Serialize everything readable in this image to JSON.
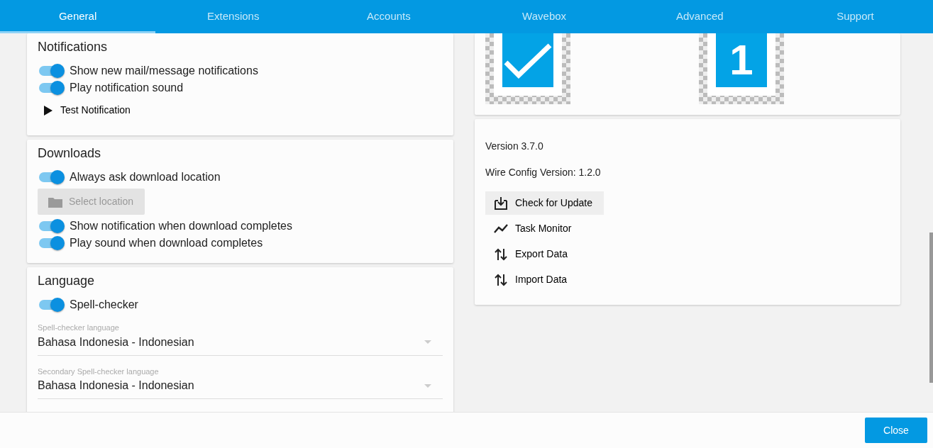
{
  "tabs": [
    {
      "label": "General",
      "selected": true
    },
    {
      "label": "Extensions",
      "selected": false
    },
    {
      "label": "Accounts",
      "selected": false
    },
    {
      "label": "Wavebox",
      "selected": false
    },
    {
      "label": "Advanced",
      "selected": false
    },
    {
      "label": "Support",
      "selected": false
    }
  ],
  "left_cards": [
    {
      "title": "Notifications",
      "items": [
        {
          "kind": "toggle",
          "label": "Show new mail/message notifications",
          "on": true
        },
        {
          "kind": "toggle",
          "label": "Play notification sound",
          "on": true
        },
        {
          "kind": "action",
          "label": "Test Notification"
        }
      ]
    },
    {
      "title": "Downloads",
      "items": [
        {
          "kind": "toggle",
          "label": "Always ask download location",
          "on": true
        },
        {
          "kind": "button",
          "label": "Select location",
          "disabled": true
        },
        {
          "kind": "toggle",
          "label": "Show notification when download completes",
          "on": true
        },
        {
          "kind": "toggle",
          "label": "Play sound when download completes",
          "on": true
        }
      ]
    },
    {
      "title": "Language",
      "items": [
        {
          "kind": "toggle",
          "label": "Spell-checker",
          "on": true
        },
        {
          "kind": "select",
          "label": "Spell-checker language",
          "value": "Bahasa Indonesia - Indonesian"
        },
        {
          "kind": "select",
          "label": "Secondary Spell-checker language",
          "value": "Bahasa Indonesia - Indonesian"
        }
      ]
    }
  ],
  "tray_previews": [
    {
      "kind": "check"
    },
    {
      "kind": "count",
      "text": "1"
    }
  ],
  "about": {
    "lines": [
      "Version 3.7.0",
      "Wire Config Version: 1.2.0"
    ],
    "actions": [
      {
        "kind": "download",
        "label": "Check for Update",
        "hovered": true
      },
      {
        "kind": "chart",
        "label": "Task Monitor",
        "hovered": false
      },
      {
        "kind": "swap",
        "label": "Export Data",
        "hovered": false
      },
      {
        "kind": "swap",
        "label": "Import Data",
        "hovered": false
      }
    ]
  },
  "footer": {
    "close_label": "Close"
  }
}
